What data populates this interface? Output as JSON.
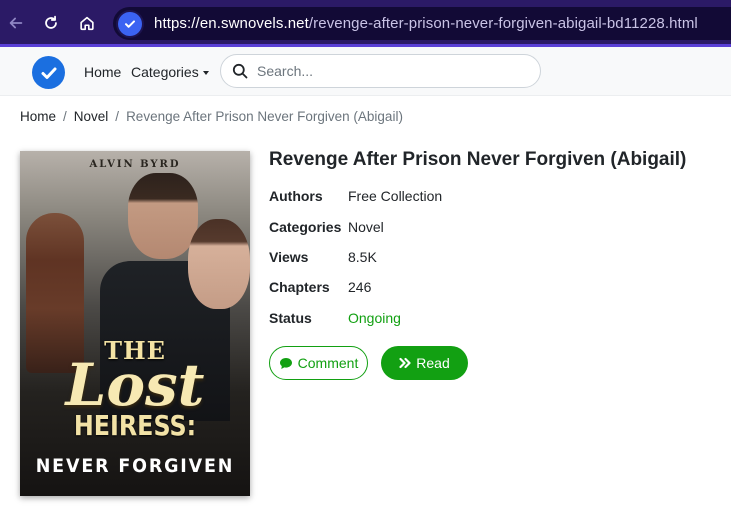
{
  "browser": {
    "url_host": "https://en.swnovels.net",
    "url_path": "/revenge-after-prison-never-forgiven-abigail-bd11228.html",
    "icons": [
      "back-arrow-icon",
      "reload-icon",
      "home-icon",
      "site-info-icon"
    ],
    "theme_color": "#2b1a66"
  },
  "header": {
    "logo_icon": "checkmark-badge-icon",
    "nav_home": "Home",
    "nav_categories": "Categories",
    "search_placeholder": "Search...",
    "logo_color": "#1b6fe0"
  },
  "breadcrumb": {
    "items": [
      "Home",
      "Novel"
    ],
    "current": "Revenge After Prison Never Forgiven (Abigail)"
  },
  "cover": {
    "author": "ALVIN BYRD",
    "title_line1": "THE",
    "title_line2": "Lost",
    "title_line3": "HEIRESS:",
    "title_line4": "NEVER FORGIVEN"
  },
  "book": {
    "title": "Revenge After Prison Never Forgiven (Abigail)",
    "details": [
      {
        "key": "Authors",
        "value": "Free Collection"
      },
      {
        "key": "Categories",
        "value": "Novel"
      },
      {
        "key": "Views",
        "value": "8.5K"
      },
      {
        "key": "Chapters",
        "value": "246"
      },
      {
        "key": "Status",
        "value": "Ongoing"
      }
    ],
    "status_color": "#12a012"
  },
  "actions": {
    "comment_label": "Comment",
    "read_label": "Read",
    "accent_color": "#12a012"
  }
}
